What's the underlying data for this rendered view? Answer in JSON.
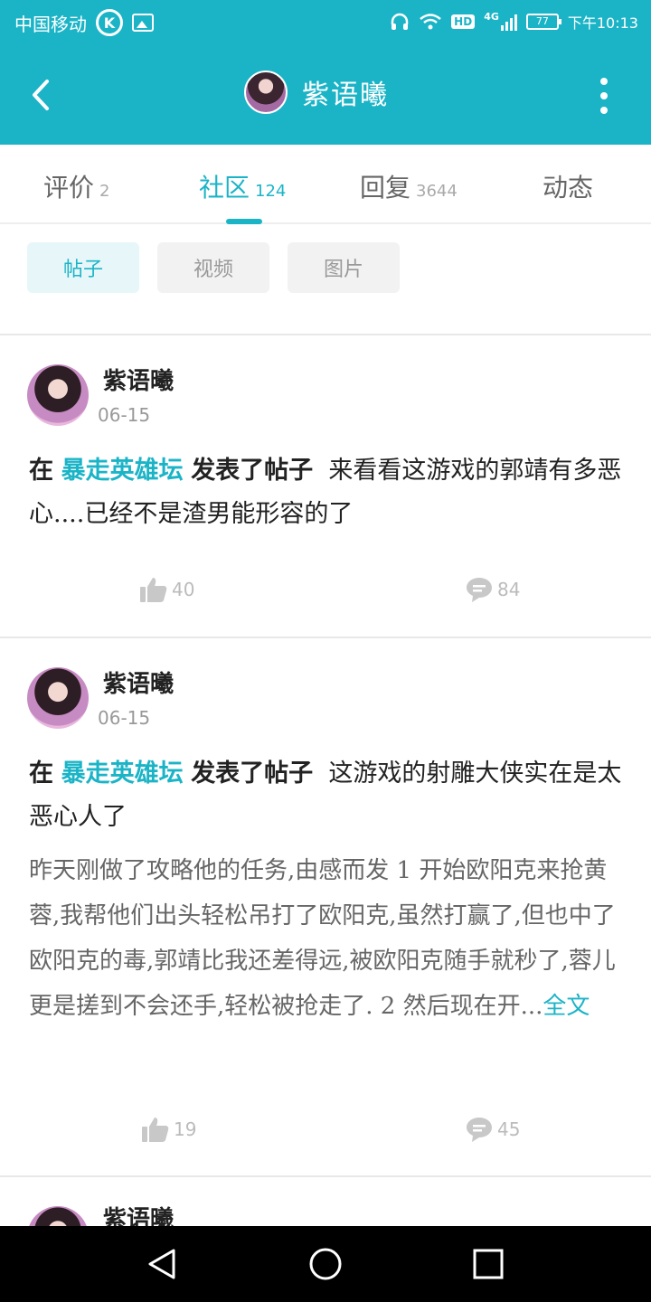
{
  "status_bar": {
    "carrier": "中国移动",
    "k_badge": "K",
    "hd_badge": "HD",
    "network": "4G",
    "battery": "77",
    "time": "下午10:13"
  },
  "app_bar": {
    "title": "紫语曦",
    "back_icon": "chevron-left-icon",
    "more_icon": "more-vertical-icon"
  },
  "tabs": [
    {
      "label": "评价",
      "count": "2"
    },
    {
      "label": "社区",
      "count": "124",
      "active": true
    },
    {
      "label": "回复",
      "count": "3644"
    },
    {
      "label": "动态",
      "count": ""
    }
  ],
  "filters": [
    {
      "label": "帖子",
      "active": true
    },
    {
      "label": "视频"
    },
    {
      "label": "图片"
    }
  ],
  "posts": [
    {
      "author": "紫语曦",
      "date": "06-15",
      "prefix": "在",
      "forum": "暴走英雄坛",
      "action": "发表了帖子",
      "title": "来看看这游戏的郭靖有多恶心....已经不是渣男能形容的了",
      "likes": "40",
      "comments": "84"
    },
    {
      "author": "紫语曦",
      "date": "06-15",
      "prefix": "在",
      "forum": "暴走英雄坛",
      "action": "发表了帖子",
      "title": "这游戏的射雕大侠实在是太恶心人了",
      "excerpt": "昨天刚做了攻略他的任务,由感而发 1 开始欧阳克来抢黄蓉,我帮他们出头轻松吊打了欧阳克,虽然打赢了,但也中了欧阳克的毒,郭靖比我还差得远,被欧阳克随手就秒了,蓉儿更是搓到不会还手,轻松被抢走了. 2 然后现在开...",
      "full_text_link": "全文",
      "likes": "19",
      "comments": "45"
    },
    {
      "author": "紫语曦"
    }
  ],
  "colors": {
    "accent": "#1bb4c7",
    "chip_active_bg": "#e6f6f9",
    "text_primary": "#222222",
    "text_secondary": "#666666",
    "muted": "#bbbbbb"
  }
}
